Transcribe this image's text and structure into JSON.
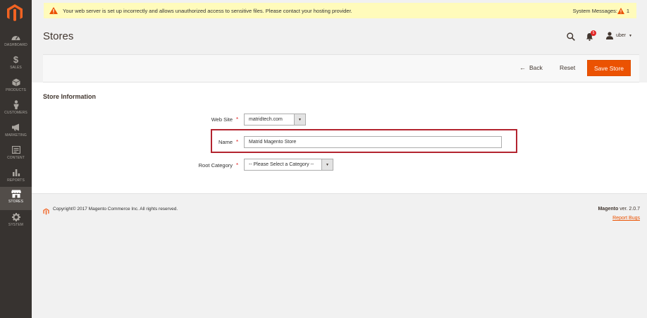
{
  "notice": {
    "text": "Your web server is set up incorrectly and allows unauthorized access to sensitive files. Please contact your hosting provider.",
    "system_messages_label": "System Messages:",
    "system_messages_count": "1"
  },
  "sidebar": {
    "items": [
      {
        "label": "DASHBOARD",
        "icon": "dashboard-icon"
      },
      {
        "label": "SALES",
        "icon": "dollar-icon"
      },
      {
        "label": "PRODUCTS",
        "icon": "cube-icon"
      },
      {
        "label": "CUSTOMERS",
        "icon": "person-icon"
      },
      {
        "label": "MARKETING",
        "icon": "megaphone-icon"
      },
      {
        "label": "CONTENT",
        "icon": "content-icon"
      },
      {
        "label": "REPORTS",
        "icon": "bar-chart-icon"
      },
      {
        "label": "STORES",
        "icon": "storefront-icon",
        "active": true
      },
      {
        "label": "SYSTEM",
        "icon": "gear-icon"
      }
    ]
  },
  "header": {
    "title": "Stores",
    "notifications_count": "5",
    "user_name": "uber"
  },
  "actions": {
    "back_label": "Back",
    "reset_label": "Reset",
    "save_label": "Save Store"
  },
  "form": {
    "section_title": "Store Information",
    "website": {
      "label": "Web Site",
      "value": "matridtech.com"
    },
    "name": {
      "label": "Name",
      "value": "Matrid Magento Store"
    },
    "root_category": {
      "label": "Root Category",
      "value": "-- Please Select a Category --"
    }
  },
  "footer": {
    "copyright": "Copyright© 2017 Magento Commerce Inc. All rights reserved.",
    "brand": "Magento",
    "version": "ver. 2.0.7",
    "report_bugs": "Report Bugs"
  },
  "colors": {
    "accent": "#eb5202",
    "sidebar_bg": "#373330",
    "notice_bg": "#fffbbb",
    "highlight": "#b3242f"
  }
}
